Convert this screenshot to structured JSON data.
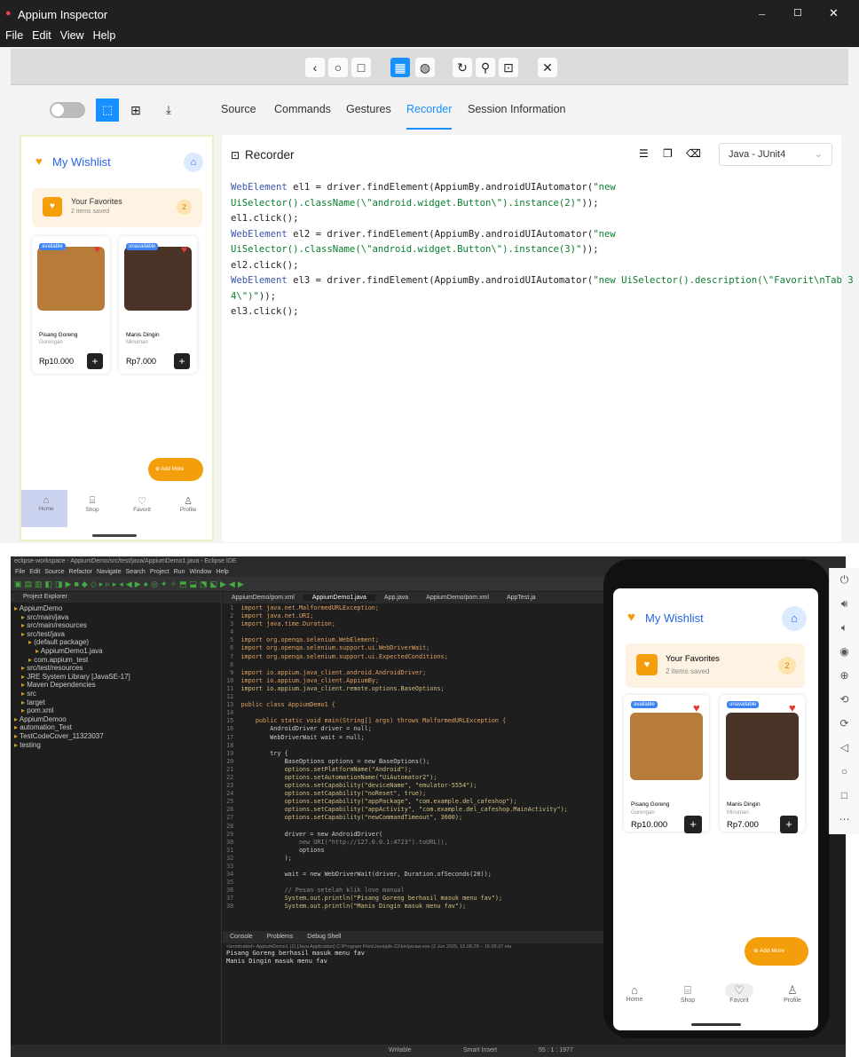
{
  "appium": {
    "title": "Appium Inspector",
    "menu": [
      "File",
      "Edit",
      "View",
      "Help"
    ],
    "tabs": [
      "Source",
      "Commands",
      "Gestures",
      "Recorder",
      "Session Information"
    ],
    "recorder_title": "Recorder",
    "language": "Java - JUnit4",
    "code": [
      {
        "kw": "WebElement",
        "rest": " el1 = driver.findElement(AppiumBy.androidUIAutomator(",
        "s": "\"new"
      },
      {
        "kw": "",
        "rest": "",
        "s": "UiSelector().className(\\\"android.widget.Button\\\").instance(2)\"",
        "tail": "));"
      },
      {
        "kw": "",
        "rest": "el1.click();",
        "s": ""
      },
      {
        "kw": "WebElement",
        "rest": " el2 = driver.findElement(AppiumBy.androidUIAutomator(",
        "s": "\"new"
      },
      {
        "kw": "",
        "rest": "",
        "s": "UiSelector().className(\\\"android.widget.Button\\\").instance(3)\"",
        "tail": "));"
      },
      {
        "kw": "",
        "rest": "el2.click();",
        "s": ""
      },
      {
        "kw": "WebElement",
        "rest": " el3 = driver.findElement(AppiumBy.androidUIAutomator(",
        "s": "\"new UiSelector().description(\\\"Favorit\\nTab 3 of"
      },
      {
        "kw": "",
        "rest": "",
        "s": "4\\\")\"",
        "tail": "));"
      },
      {
        "kw": "",
        "rest": "el3.click();",
        "s": ""
      }
    ]
  },
  "wishlist": {
    "title": "My Wishlist",
    "fav_title": "Your Favorites",
    "fav_sub": "2 items saved",
    "fav_count": "2",
    "items": [
      {
        "badge": "available",
        "name": "Pisang Goreng",
        "cat": "Gorengan",
        "price": "Rp10.000",
        "badge_color": "#3b82f6"
      },
      {
        "badge": "unavailable",
        "name": "Manis Dingin",
        "cat": "Minuman",
        "price": "Rp7.000",
        "badge_color": "#3b82f6"
      }
    ],
    "add_more": "Add More",
    "nav": [
      "Home",
      "Shop",
      "Favorit",
      "Profile"
    ]
  },
  "eclipse": {
    "title": "eclipse-workspace - AppiumDemo/src/test/java/AppiumDemo1.java - Eclipse IDE",
    "menu": [
      "File",
      "Edit",
      "Source",
      "Refactor",
      "Navigate",
      "Search",
      "Project",
      "Run",
      "Window",
      "Help"
    ],
    "explorer_title": "Project Explorer",
    "tree": [
      "AppiumDemo",
      "src/main/java",
      "src/main/resources",
      "src/test/java",
      "(default package)",
      "AppiumDemo1.java",
      "com.appium_test",
      "src/test/resources",
      "JRE System Library [JavaSE-17]",
      "Maven Dependencies",
      "src",
      "target",
      "pom.xml",
      "AppiumDemoo",
      "automation_Test",
      "TestCodeCover_11323037",
      "testing"
    ],
    "tabs": [
      "AppiumDemo/pom.xml",
      "AppiumDemo1.java",
      "App.java",
      "AppiumDemo/pom.xml",
      "AppTest.ja"
    ],
    "code": [
      "import java.net.MalformedURLException;",
      "import java.net.URI;",
      "import java.time.Duration;",
      "",
      "import org.openqa.selenium.WebElement;",
      "import org.openqa.selenium.support.ui.WebDriverWait;",
      "import org.openqa.selenium.support.ui.ExpectedConditions;",
      "",
      "import io.appium.java_client.android.AndroidDriver;",
      "import io.appium.java_client.AppiumBy;",
      "import io.appium.java_client.remote.options.BaseOptions;",
      "",
      "public class AppiumDemo1 {",
      "",
      "    public static void main(String[] args) throws MalformedURLException {",
      "        AndroidDriver driver = null;",
      "        WebDriverWait wait = null;",
      "",
      "        try {",
      "            BaseOptions options = new BaseOptions();",
      "            options.setPlatformName(\"Android\");",
      "            options.setAutomationName(\"UiAutomator2\");",
      "            options.setCapability(\"deviceName\", \"emulator-5554\");",
      "            options.setCapability(\"noReset\", true);",
      "            options.setCapability(\"appPackage\", \"com.example.del_cafeshop\");",
      "            options.setCapability(\"appActivity\", \"com.example.del_cafeshop.MainActivity\");",
      "            options.setCapability(\"newCommandTimeout\", 3600);",
      "",
      "            driver = new AndroidDriver(",
      "                new URI(\"http://127.0.0.1:4723\").toURL(),",
      "                options",
      "            );",
      "",
      "            wait = new WebDriverWait(driver, Duration.ofSeconds(20));",
      "",
      "            // Pesan setelah klik love manual",
      "            System.out.println(\"Pisang Goreng berhasil masuk menu fav\");",
      "            System.out.println(\"Manis Dingin masuk menu fav\");"
    ],
    "console_tabs": [
      "Console",
      "Problems",
      "Debug Shell"
    ],
    "console_header": "<terminated> AppiumDemo1 (1) [Java Application] C:\\Program Files\\Java\\jdk-22\\bin\\javaw.exe (2 Jun 2025, 15.08.28 – 15.08.37 ela",
    "console_out": [
      "Pisang Goreng berhasil masuk menu fav",
      "Manis Dingin masuk menu fav"
    ],
    "status": [
      "Writable",
      "Smart Insert",
      "55 : 1 : 1977"
    ]
  }
}
